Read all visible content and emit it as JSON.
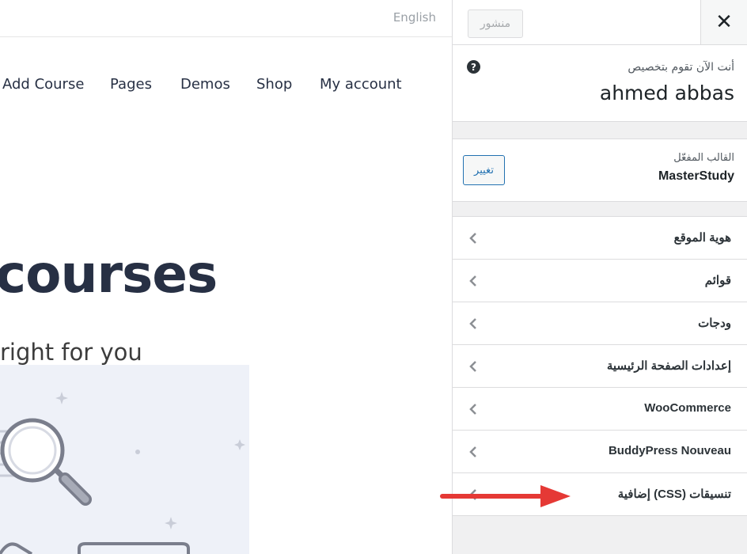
{
  "preview": {
    "language": "English",
    "nav": [
      "Add Course",
      "Pages",
      "Demos",
      "Shop",
      "My account"
    ],
    "hero_title": "courses",
    "hero_subtitle": "right for you"
  },
  "customizer": {
    "publish_label": "منشور",
    "close_symbol": "✕",
    "help_symbol": "?",
    "customizing_label": "أنت الآن تقوم بتخصيص",
    "site_name": "ahmed abbas",
    "active_theme_label": "القالب المفعّل",
    "theme_name": "MasterStudy",
    "change_label": "تغيير",
    "sections": [
      {
        "label": "هوية الموقع"
      },
      {
        "label": "قوائم"
      },
      {
        "label": "ودجات"
      },
      {
        "label": "إعدادات الصفحة الرئيسية"
      },
      {
        "label": "WooCommerce"
      },
      {
        "label": "BuddyPress Nouveau"
      },
      {
        "label": "تنسيقات (CSS) إضافية"
      }
    ]
  },
  "colors": {
    "accent": "#2271b1",
    "panel_bg": "#f0f0f1",
    "annotation_arrow": "#e53935",
    "heading": "#273044"
  },
  "icons": {
    "help": "question-circle-icon",
    "close": "close-icon",
    "section_chevron": "chevron-left-icon"
  }
}
